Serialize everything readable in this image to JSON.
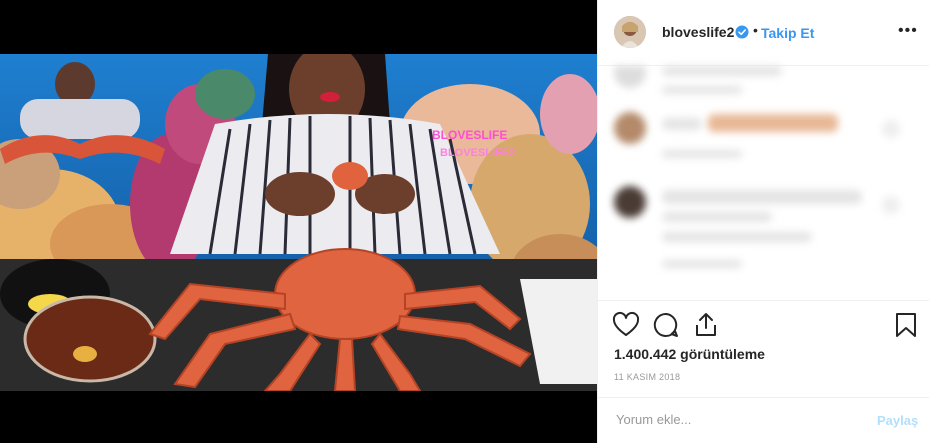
{
  "video": {
    "watermark_line1": "BLOVESLIFE",
    "watermark_line2": "BLOVESLIFE2"
  },
  "header": {
    "username": "bloveslife2",
    "separator": "•",
    "follow_label": "Takip Et",
    "more_label": "•••"
  },
  "stats": {
    "views": "1.400.442 görüntüleme",
    "date": "11 KASIM 2018"
  },
  "comment": {
    "placeholder": "Yorum ekle...",
    "post_label": "Paylaş"
  },
  "icons": {
    "like": "heart-icon",
    "comment": "comment-icon",
    "share": "share-icon",
    "save": "bookmark-icon",
    "verified": "verified-badge-icon",
    "more": "more-options-icon"
  },
  "colors": {
    "link": "#3897f0",
    "post_disabled": "#b2dffc",
    "text": "#262626",
    "muted": "#999999"
  }
}
